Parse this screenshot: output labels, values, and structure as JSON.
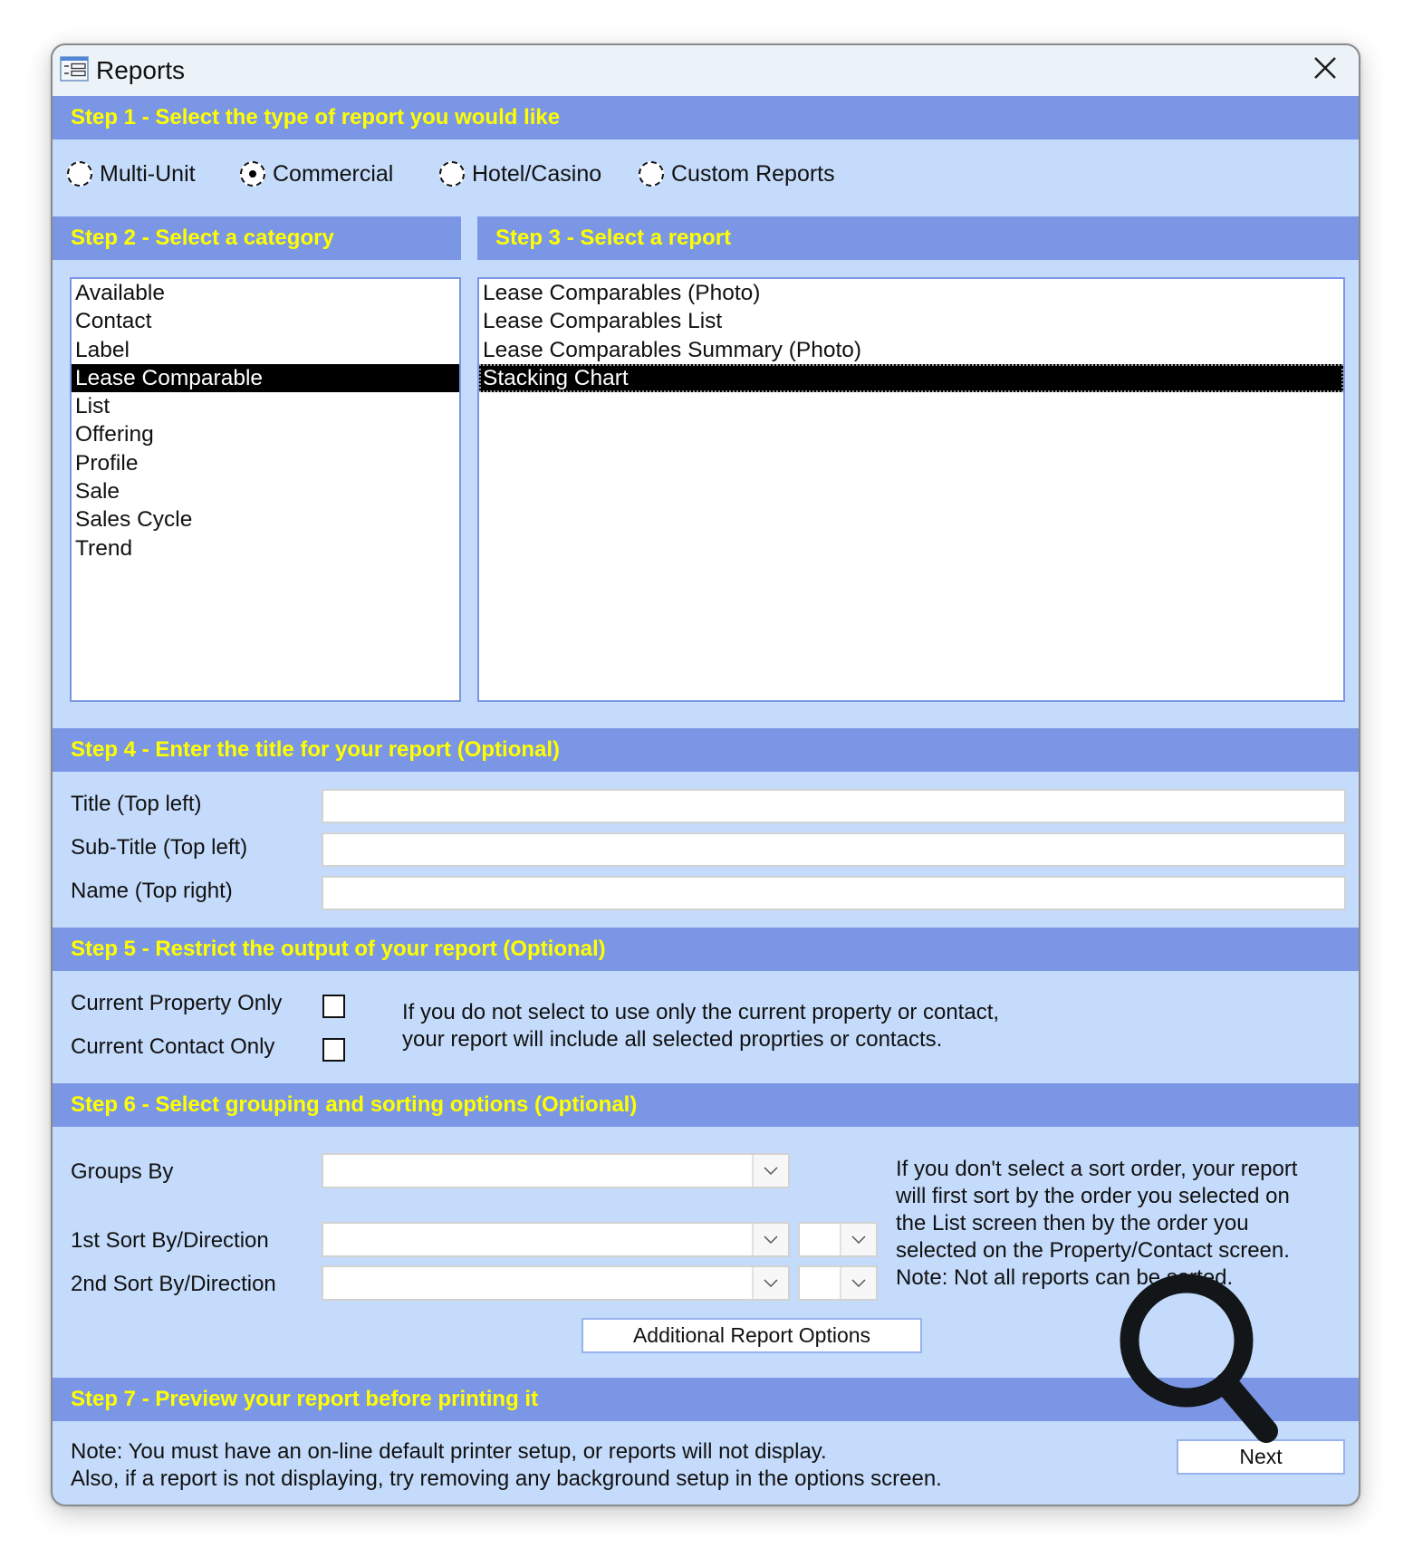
{
  "window": {
    "title": "Reports",
    "icon": "form-window-icon",
    "close_icon": "close-icon"
  },
  "step1": {
    "header": "Step 1 - Select the type of report you would like",
    "options": [
      {
        "label": "Multi-Unit",
        "checked": false
      },
      {
        "label": "Commercial",
        "checked": true
      },
      {
        "label": "Hotel/Casino",
        "checked": false
      },
      {
        "label": "Custom Reports",
        "checked": false
      }
    ]
  },
  "step2": {
    "header": "Step 2 - Select a category",
    "items": [
      "Available",
      "Contact",
      "Label",
      "Lease Comparable",
      "List",
      "Offering",
      "Profile",
      "Sale",
      "Sales Cycle",
      "Trend"
    ],
    "selected": "Lease Comparable"
  },
  "step3": {
    "header": "Step 3 - Select a report",
    "items": [
      "Lease Comparables (Photo)",
      "Lease Comparables List",
      "Lease Comparables Summary (Photo)",
      "Stacking Chart"
    ],
    "selected": "Stacking Chart"
  },
  "step4": {
    "header": "Step 4 - Enter the title for your report (Optional)",
    "fields": [
      {
        "label": "Title (Top left)",
        "value": "",
        "placeholder": ""
      },
      {
        "label": "Sub-Title (Top left)",
        "value": "",
        "placeholder": ""
      },
      {
        "label": "Name (Top right)",
        "value": "",
        "placeholder": ""
      }
    ]
  },
  "step5": {
    "header": "Step 5 - Restrict the output of your report (Optional)",
    "checkboxes": [
      {
        "label": "Current Property Only",
        "checked": false
      },
      {
        "label": "Current Contact Only",
        "checked": false
      }
    ],
    "info_line1": "If you do not select to use only the current property or contact,",
    "info_line2": "your report will include all selected proprties or contacts."
  },
  "step6": {
    "header": "Step 6 - Select grouping and sorting options (Optional)",
    "groups_by_label": "Groups By",
    "groups_by_value": "",
    "sort1_label": "1st Sort By/Direction",
    "sort1_value": "",
    "sort1_direction": "",
    "sort2_label": "2nd Sort By/Direction",
    "sort2_value": "",
    "sort2_direction": "",
    "info_lines": [
      "If you don't select a sort order, your report",
      "will first sort by the order you selected on",
      "the List screen then by the order you",
      "selected on the Property/Contact screen.",
      "Note: Not all reports can be sorted."
    ],
    "additional_button": "Additional Report Options"
  },
  "step7": {
    "header": "Step 7 - Preview your report before printing it",
    "note_line1": "Note:  You must have an on-line default printer setup, or reports will not display.",
    "note_line2": "Also, if a report is not displaying, try removing any background setup in the options screen.",
    "next_button": "Next"
  },
  "overlay": {
    "icon": "magnifier-icon"
  },
  "colors": {
    "header_bg": "#7a96e4",
    "header_text": "#ffff00",
    "body_bg": "#c5dbfb",
    "titlebar_bg": "#ebf3f8",
    "selection_bg": "#000000"
  }
}
